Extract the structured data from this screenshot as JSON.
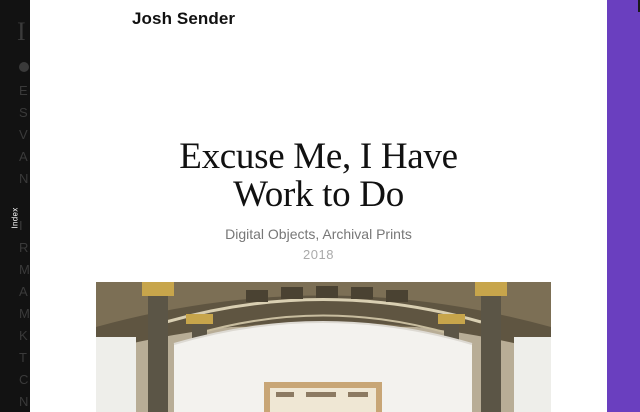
{
  "left_panel": {
    "index_tab_label": "Index"
  },
  "project": {
    "artist": "Josh Sender",
    "title_line1": "Excuse Me, I Have",
    "title_line2": "Work to Do",
    "medium": "Digital Objects, Archival Prints",
    "year": "2018"
  },
  "colors": {
    "accent_purple": "#6a3fbf",
    "background_dark": "#121212",
    "panel_white": "#ffffff"
  },
  "icons": [
    "exhibition-photo"
  ]
}
